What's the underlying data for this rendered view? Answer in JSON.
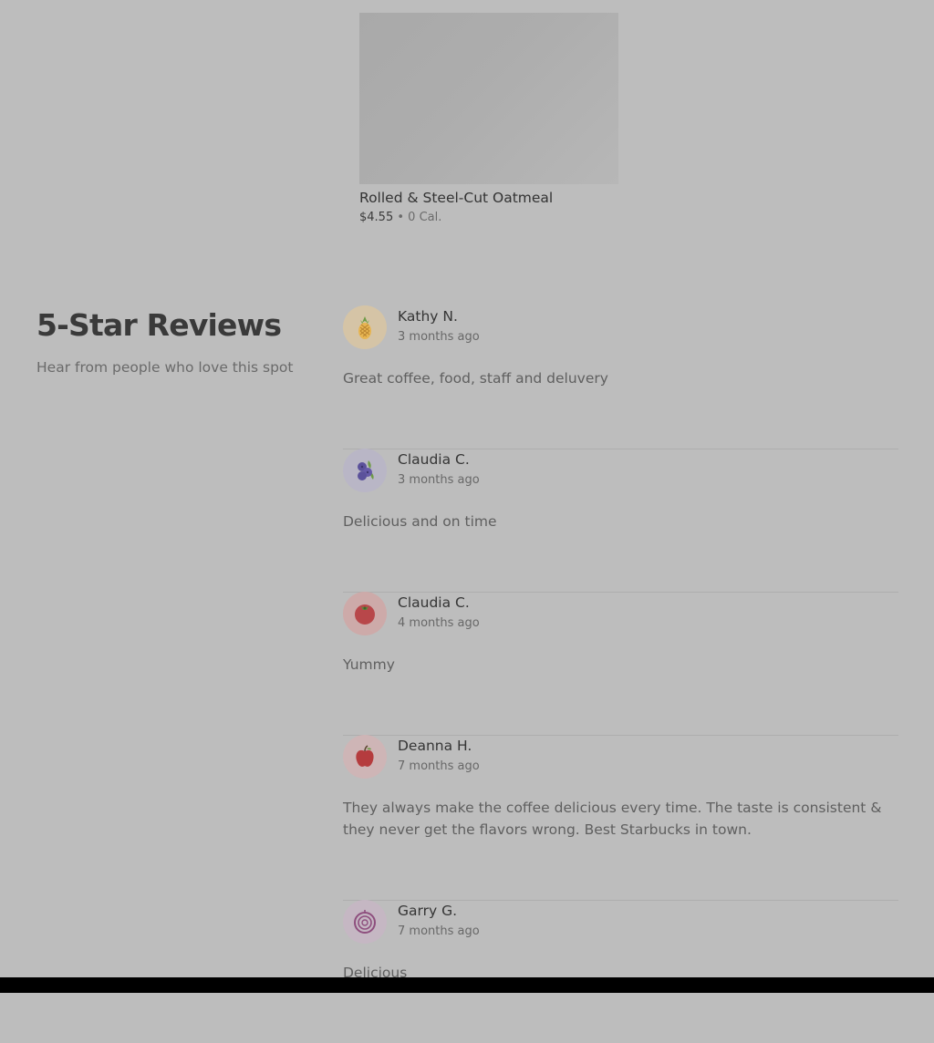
{
  "product": {
    "name": "Rolled & Steel-Cut Oatmeal",
    "price": "$4.55",
    "separator": "•",
    "calories": "0 Cal."
  },
  "reviews_section": {
    "title": "5-Star Reviews",
    "subtitle": "Hear from people who love this spot"
  },
  "reviews": [
    {
      "name": "Kathy N.",
      "date": "3 months ago",
      "text": "Great coffee, food, staff and deluvery",
      "avatar_icon": "pineapple-icon",
      "avatar_bg": "#d5c4a6"
    },
    {
      "name": "Claudia C.",
      "date": "3 months ago",
      "text": "Delicious and on time",
      "avatar_icon": "blueberries-icon",
      "avatar_bg": "#b9b6c6"
    },
    {
      "name": "Claudia C.",
      "date": "4 months ago",
      "text": "Yummy",
      "avatar_icon": "tomato-icon",
      "avatar_bg": "#cdaaa9"
    },
    {
      "name": "Deanna H.",
      "date": "7 months ago",
      "text": "They always make the coffee delicious every time. The taste is consistent & they never get the flavors wrong. Best Starbucks in town.",
      "avatar_icon": "apple-icon",
      "avatar_bg": "#ceb5b6"
    },
    {
      "name": "Garry G.",
      "date": "7 months ago",
      "text": "Delicious",
      "avatar_icon": "onion-icon",
      "avatar_bg": "#c5b7c3"
    }
  ]
}
